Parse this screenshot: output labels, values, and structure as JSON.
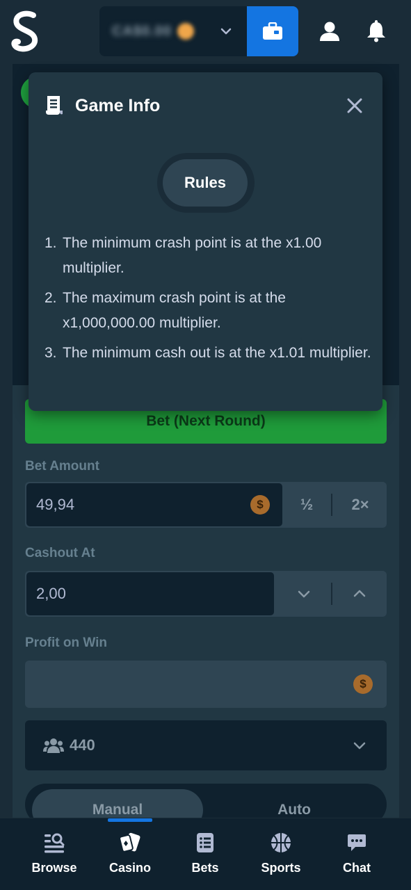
{
  "header": {
    "balance_amount": "CA$0.00",
    "icons": [
      "logo",
      "chevron-down-icon",
      "wallet-icon",
      "user-icon",
      "bell-icon"
    ]
  },
  "game": {
    "bet_button_label": "Bet (Next Round)",
    "bet_amount_label": "Bet Amount",
    "bet_amount_value": "49,94",
    "half_label": "½",
    "double_label": "2×",
    "cashout_label": "Cashout At",
    "cashout_value": "2,00",
    "profit_label": "Profit on Win",
    "profit_value": "",
    "coin_symbol": "$",
    "players_count": "440",
    "tab_manual": "Manual",
    "tab_auto": "Auto"
  },
  "modal": {
    "title": "Game Info",
    "tab_rules": "Rules",
    "rules": [
      {
        "num": "1.",
        "text": "The minimum crash point is at the x1.00 multiplier."
      },
      {
        "num": "2.",
        "text": "The maximum crash point is at the x1,000,000.00 multiplier."
      },
      {
        "num": "3.",
        "text": "The minimum cash out is at the x1.01 multiplier."
      }
    ]
  },
  "bottom_nav": {
    "items": [
      {
        "label": "Browse",
        "icon": "browse-icon"
      },
      {
        "label": "Casino",
        "icon": "casino-icon"
      },
      {
        "label": "Bets",
        "icon": "bets-icon"
      },
      {
        "label": "Sports",
        "icon": "sports-icon"
      },
      {
        "label": "Chat",
        "icon": "chat-icon"
      }
    ],
    "active": "Casino"
  },
  "colors": {
    "background": "#1a2c38",
    "panel": "#213743",
    "dark": "#0f212e",
    "accent_blue": "#1475e1",
    "bet_green": "#1f9b3a"
  }
}
